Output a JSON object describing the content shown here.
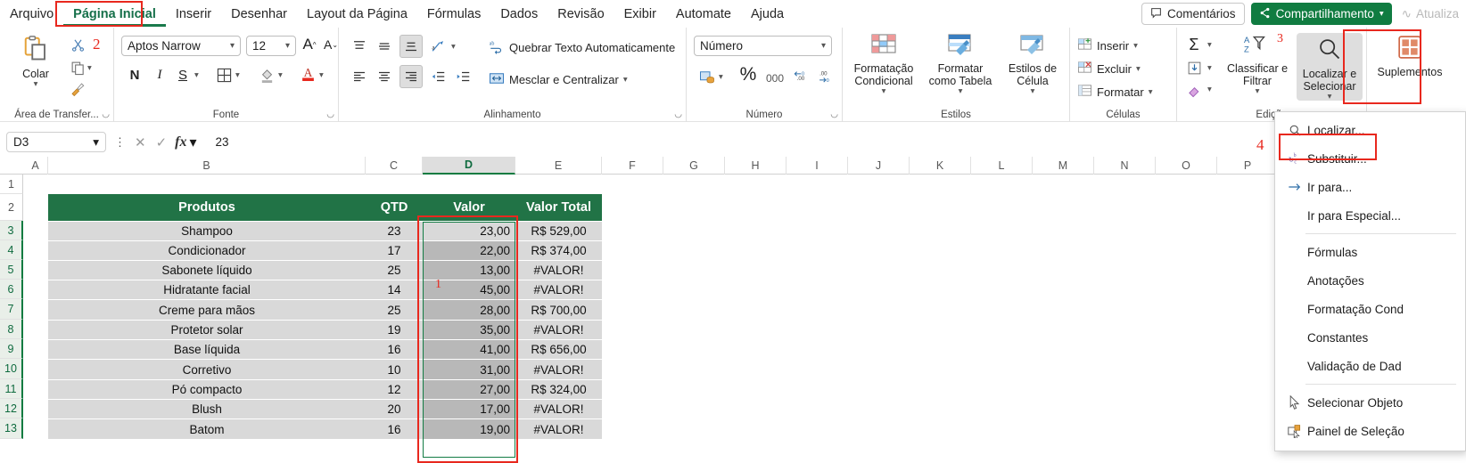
{
  "tabs": [
    {
      "label": "Arquivo",
      "active": false
    },
    {
      "label": "Página Inicial",
      "active": true
    },
    {
      "label": "Inserir",
      "active": false
    },
    {
      "label": "Desenhar",
      "active": false
    },
    {
      "label": "Layout da Página",
      "active": false
    },
    {
      "label": "Fórmulas",
      "active": false
    },
    {
      "label": "Dados",
      "active": false
    },
    {
      "label": "Revisão",
      "active": false
    },
    {
      "label": "Exibir",
      "active": false
    },
    {
      "label": "Automate",
      "active": false
    },
    {
      "label": "Ajuda",
      "active": false
    }
  ],
  "titlebar": {
    "comments": "Comentários",
    "share": "Compartilhamento",
    "update": "Atualiza"
  },
  "ribbon": {
    "clipboard": {
      "group_label": "Área de Transfer...",
      "paste": "Colar",
      "cut": "cut-icon",
      "copy": "copy-icon",
      "format_painter": "format-painter-icon"
    },
    "font": {
      "group_label": "Fonte",
      "family": "Aptos Narrow",
      "size": "12",
      "grow": "A˄",
      "shrink": "A˅",
      "bold": "N",
      "italic": "I",
      "underline": "S",
      "borders": "borders-icon",
      "fill": "fill-color-icon",
      "font_color": "font-color-icon"
    },
    "alignment": {
      "group_label": "Alinhamento",
      "wrap_text": "Quebrar Texto Automaticamente",
      "merge": "Mesclar e Centralizar"
    },
    "number": {
      "group_label": "Número",
      "format": "Número",
      "percent": "%",
      "comma": "000",
      "dec_decrease": ".00",
      "dec_increase": ".0"
    },
    "styles": {
      "group_label": "Estilos",
      "conditional": "Formatação Condicional",
      "table": "Formatar como Tabela",
      "cell": "Estilos de Célula"
    },
    "cells": {
      "group_label": "Células",
      "insert": "Inserir",
      "delete": "Excluir",
      "format": "Formatar"
    },
    "editing": {
      "group_label": "Edição",
      "autosum": "Σ",
      "fill": "fill-down-icon",
      "clear": "clear-icon",
      "sort_filter": "Classificar e Filtrar",
      "find_select": "Localizar e Selecionar"
    },
    "addins": {
      "label": "Suplementos"
    }
  },
  "annotations": {
    "one": "1",
    "two": "2",
    "three": "3",
    "four": "4"
  },
  "formula_bar": {
    "name_box": "D3",
    "formula": "23",
    "cancel": "✕",
    "confirm": "✓",
    "fx": "fx"
  },
  "menu": {
    "items": [
      {
        "label": "Localizar...",
        "icon": "search-icon",
        "sep_after": false
      },
      {
        "label": "Substituir...",
        "icon": "replace-icon",
        "sep_after": false
      },
      {
        "label": "Ir para...",
        "icon": "arrow-right-icon",
        "sep_after": false
      },
      {
        "label": "Ir para Especial...",
        "icon": "",
        "sep_after": true
      },
      {
        "label": "Fórmulas",
        "icon": "",
        "sep_after": false
      },
      {
        "label": "Anotações",
        "icon": "",
        "sep_after": false
      },
      {
        "label": "Formatação Cond",
        "icon": "",
        "sep_after": false
      },
      {
        "label": "Constantes",
        "icon": "",
        "sep_after": false
      },
      {
        "label": "Validação de Dad",
        "icon": "",
        "sep_after": true
      },
      {
        "label": "Selecionar Objeto",
        "icon": "cursor-icon",
        "sep_after": false
      },
      {
        "label": "Painel de Seleção",
        "icon": "selection-pane-icon",
        "sep_after": false
      }
    ]
  },
  "sheet": {
    "columns": [
      "A",
      "B",
      "C",
      "D",
      "E",
      "F",
      "G",
      "H",
      "I",
      "J",
      "K",
      "L",
      "M",
      "N",
      "O",
      "P"
    ],
    "selected_column": "D",
    "rows": [
      1,
      2,
      3,
      4,
      5,
      6,
      7,
      8,
      9,
      10,
      11,
      12,
      13
    ],
    "selected_rows": [
      3,
      4,
      5,
      6,
      7,
      8,
      9,
      10,
      11,
      12,
      13
    ],
    "headers": {
      "b": "Produtos",
      "c": "QTD",
      "d": "Valor",
      "e": "Valor Total"
    },
    "data": [
      {
        "row": 3,
        "produto": "Shampoo",
        "qtd": "23",
        "valor": "23,00",
        "total": "R$ 529,00",
        "error": false
      },
      {
        "row": 4,
        "produto": "Condicionador",
        "qtd": "17",
        "valor": "22,00",
        "total": "R$ 374,00",
        "error": false
      },
      {
        "row": 5,
        "produto": "Sabonete líquido",
        "qtd": "25",
        "valor": "13,00",
        "total": "#VALOR!",
        "error": true
      },
      {
        "row": 6,
        "produto": "Hidratante facial",
        "qtd": "14",
        "valor": "45,00",
        "total": "#VALOR!",
        "error": true
      },
      {
        "row": 7,
        "produto": "Creme para mãos",
        "qtd": "25",
        "valor": "28,00",
        "total": "R$ 700,00",
        "error": false
      },
      {
        "row": 8,
        "produto": "Protetor solar",
        "qtd": "19",
        "valor": "35,00",
        "total": "#VALOR!",
        "error": true
      },
      {
        "row": 9,
        "produto": "Base líquida",
        "qtd": "16",
        "valor": "41,00",
        "total": "R$ 656,00",
        "error": false
      },
      {
        "row": 10,
        "produto": "Corretivo",
        "qtd": "10",
        "valor": "31,00",
        "total": "#VALOR!",
        "error": true
      },
      {
        "row": 11,
        "produto": "Pó compacto",
        "qtd": "12",
        "valor": "27,00",
        "total": "R$ 324,00",
        "error": false
      },
      {
        "row": 12,
        "produto": "Blush",
        "qtd": "20",
        "valor": "17,00",
        "total": "#VALOR!",
        "error": true
      },
      {
        "row": 13,
        "produto": "Batom",
        "qtd": "16",
        "valor": "19,00",
        "total": "#VALOR!",
        "error": true
      }
    ]
  },
  "colors": {
    "excel_green": "#217346",
    "accent_red": "#e8281e",
    "header_green": "#217346",
    "cell_gray": "#d9d9d9"
  }
}
